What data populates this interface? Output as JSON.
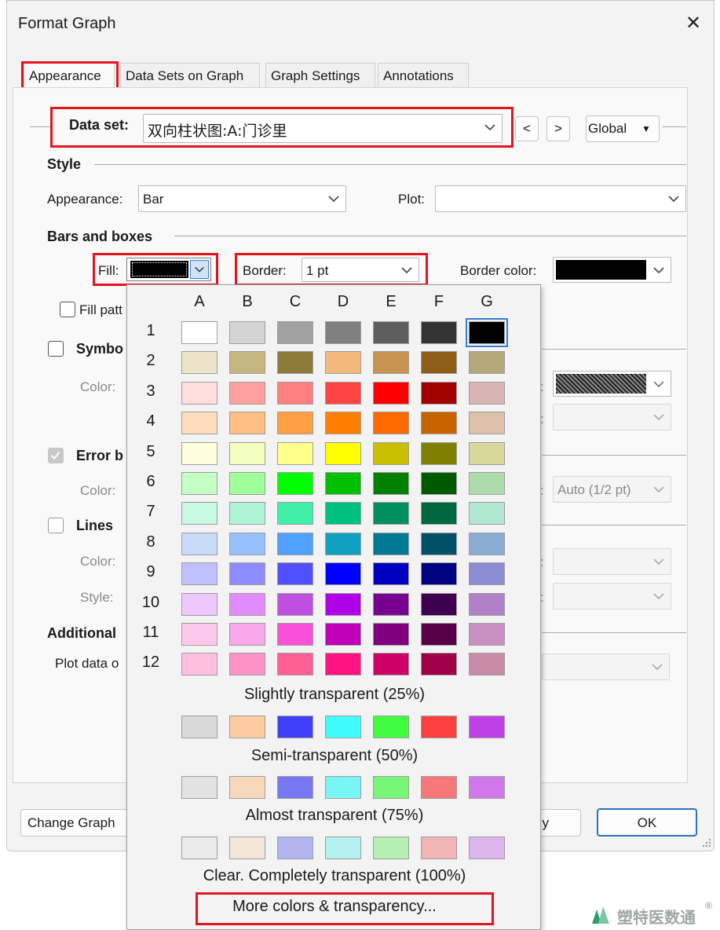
{
  "window": {
    "title": "Format Graph",
    "close_glyph": "✕"
  },
  "tabs": [
    "Appearance",
    "Data Sets on Graph",
    "Graph Settings",
    "Annotations"
  ],
  "dataset": {
    "label": "Data set:",
    "value": "双向柱状图:A:门诊里",
    "prev": "<",
    "next": ">",
    "scope": "Global"
  },
  "style": {
    "heading": "Style",
    "appearance_label": "Appearance:",
    "appearance_value": "Bar",
    "plot_label": "Plot:",
    "plot_value": ""
  },
  "bars": {
    "heading": "Bars and boxes",
    "fill_label": "Fill:",
    "border_label": "Border:",
    "border_value": "1 pt",
    "border_color_label": "Border color:",
    "fill_pattern_label": "Fill patt"
  },
  "symbols": {
    "label": "Symbo",
    "color_label": "Color:"
  },
  "error_bars": {
    "label": "Error b",
    "color_label": "Color:",
    "width_value": "Auto (1/2 pt)"
  },
  "lines": {
    "label": "Lines",
    "color_label": "Color:",
    "style_label": "Style:"
  },
  "additional": {
    "label": "Additional",
    "plot_data_label": "Plot data o"
  },
  "buttons": {
    "change_graph": "Change Graph",
    "apply_partial": "y",
    "ok": "OK"
  },
  "popup": {
    "columns": [
      "A",
      "B",
      "C",
      "D",
      "E",
      "F",
      "G"
    ],
    "rows": [
      "1",
      "2",
      "3",
      "4",
      "5",
      "6",
      "7",
      "8",
      "9",
      "10",
      "11",
      "12"
    ],
    "grid": [
      [
        "#ffffff",
        "#d4d4d4",
        "#a2a2a2",
        "#808080",
        "#5e5e5e",
        "#333333",
        "#000000"
      ],
      [
        "#ece4c8",
        "#c5b57e",
        "#8b7a38",
        "#f2b87c",
        "#c79350",
        "#8e5d18",
        "#b2a878"
      ],
      [
        "#ffdede",
        "#ffa0a0",
        "#ff8080",
        "#ff4444",
        "#ff0000",
        "#a00000",
        "#d9b4b4"
      ],
      [
        "#ffdcbe",
        "#ffbe82",
        "#ff9e42",
        "#ff8000",
        "#ff6a00",
        "#c86400",
        "#dcc0a8"
      ],
      [
        "#ffffde",
        "#f2ffbe",
        "#ffff8c",
        "#ffff00",
        "#c8c000",
        "#808000",
        "#d8d89a"
      ],
      [
        "#c4ffc4",
        "#a0ff9a",
        "#00ff00",
        "#00c000",
        "#008000",
        "#005a00",
        "#acdcac"
      ],
      [
        "#c8f8e4",
        "#b0f4d8",
        "#40f0a8",
        "#00c080",
        "#009060",
        "#006840",
        "#b0e8d4"
      ],
      [
        "#c8dcfa",
        "#96c0ff",
        "#50a0ff",
        "#10a0c0",
        "#007894",
        "#005068",
        "#8cacd4"
      ],
      [
        "#c0c0ff",
        "#8c8cff",
        "#5050ff",
        "#0000ff",
        "#0000c0",
        "#000080",
        "#8c8cd4"
      ],
      [
        "#ecc8ff",
        "#e08cff",
        "#c050e0",
        "#b000e8",
        "#780090",
        "#400050",
        "#b080c8"
      ],
      [
        "#fcc8ec",
        "#f8a8e8",
        "#f850d8",
        "#c000b8",
        "#800080",
        "#580048",
        "#c890c0"
      ],
      [
        "#ffbede",
        "#fc94c8",
        "#ff6094",
        "#ff1480",
        "#cc0066",
        "#a00048",
        "#c88ca8"
      ]
    ],
    "slight_title": "Slightly transparent (25%)",
    "slight": [
      "#dadada",
      "#fdcca0",
      "#4040f8",
      "#40fcfc",
      "#40fc40",
      "#fc4040",
      "#c040e8"
    ],
    "semi_title": "Semi-transparent (50%)",
    "semi": [
      "#e2e2e2",
      "#f7d8bd",
      "#7878f2",
      "#78f6f6",
      "#78f678",
      "#f67878",
      "#d078ea"
    ],
    "almost_title": "Almost transparent (75%)",
    "almost": [
      "#ebebeb",
      "#f4e6d8",
      "#b4b4f0",
      "#b4f0f0",
      "#b4f0b4",
      "#f0b4b4",
      "#dcb4ec"
    ],
    "clear_title": "Clear. Completely transparent (100%)",
    "more_link": "More colors & transparency..."
  },
  "colors": {
    "highlight_red": "#e3141e",
    "selection_blue": "#3a7bd5"
  },
  "watermark": {
    "text": "塑特医数通",
    "mark": "®"
  }
}
